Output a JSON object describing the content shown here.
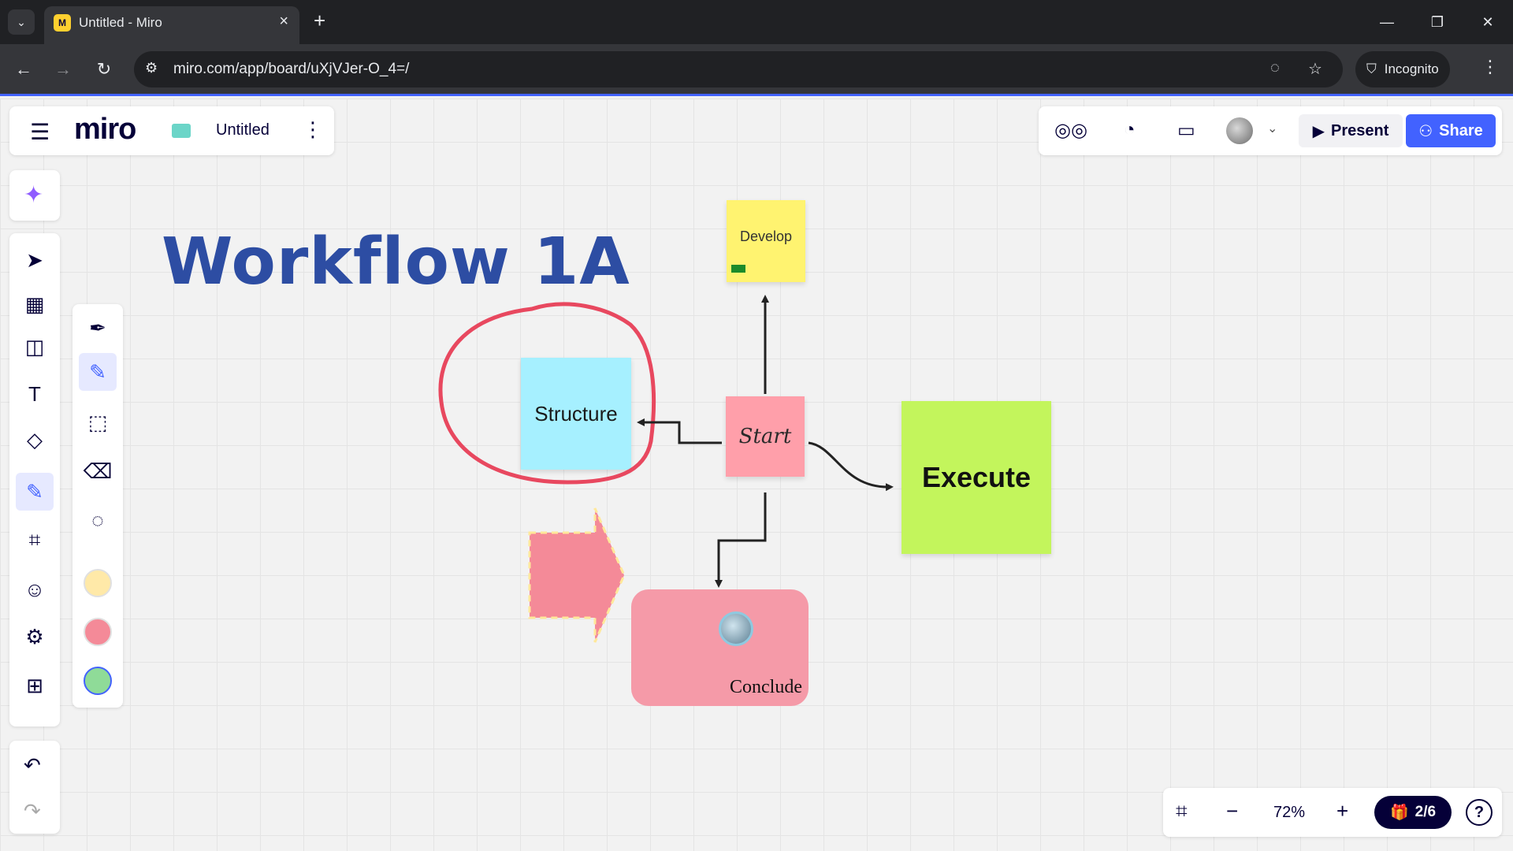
{
  "browser": {
    "tab_title": "Untitled - Miro",
    "url": "miro.com/app/board/uXjVJer-O_4=/",
    "incognito_label": "Incognito",
    "icons": [
      "chevron-down-icon",
      "miro-favicon",
      "close-icon",
      "plus-icon",
      "minimize-icon",
      "restore-icon",
      "close-window-icon",
      "back-icon",
      "forward-icon",
      "reload-icon",
      "site-info-icon",
      "eye-off-icon",
      "star-icon",
      "incognito-icon",
      "more-vert-icon"
    ]
  },
  "header": {
    "logo": "miro",
    "board_title": "Untitled",
    "board_color": "#6bd5c8"
  },
  "collab": {
    "present_label": "Present",
    "share_label": "Share",
    "share_color": "#4262ff"
  },
  "tools": {
    "main": [
      "ai-sparkle",
      "select",
      "templates",
      "sticky-note",
      "text",
      "shapes",
      "pen",
      "frame",
      "stickers",
      "more-apps",
      "add"
    ],
    "active": "pen",
    "pen_options": [
      "pen",
      "highlighter",
      "smart-draw",
      "eraser",
      "lasso"
    ],
    "swatches": [
      "#ffe9a8",
      "#f48a98",
      "#8fdb98"
    ]
  },
  "zoom": {
    "value": "72%",
    "page_indicator": "2/6"
  },
  "board": {
    "title": "Workflow 1A",
    "title_color": "#2d4da3",
    "develop": "Develop",
    "structure": "Structure",
    "start": "Start",
    "execute": "Execute",
    "conclude": "Conclude",
    "colors": {
      "develop": "#fff370",
      "structure": "#a6f0ff",
      "start": "#ff9faa",
      "execute": "#c3f55c",
      "conclude": "#f59aa8",
      "circle_stroke": "#e8485f"
    }
  }
}
